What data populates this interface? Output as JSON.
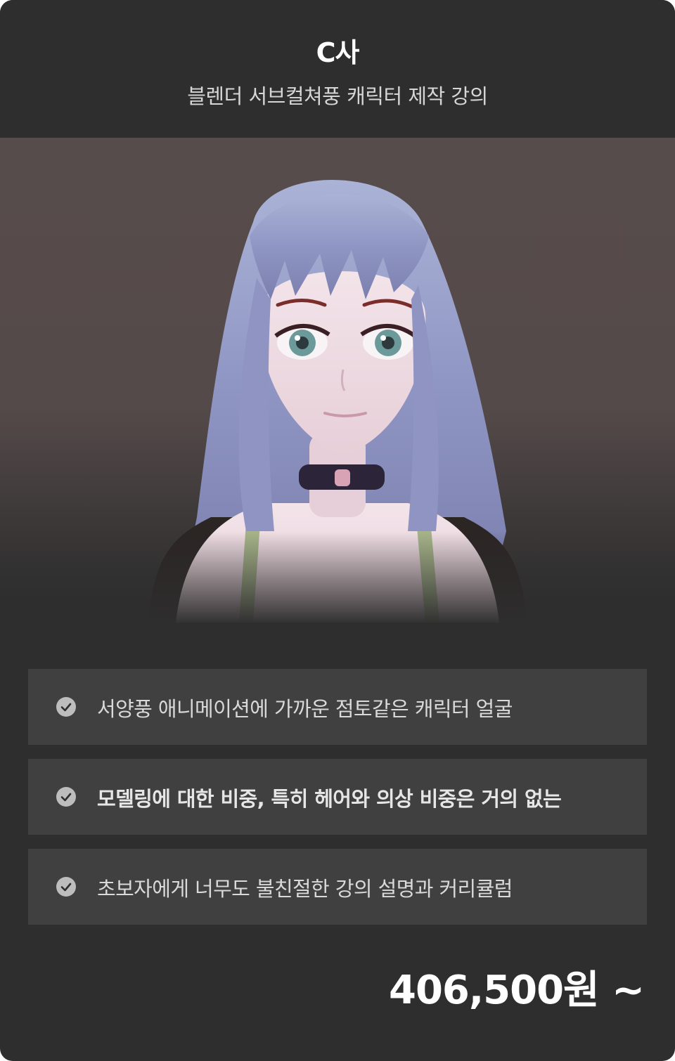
{
  "header": {
    "title": "C사",
    "subtitle": "블렌더 서브컬쳐풍 캐릭터 제작 강의"
  },
  "hero": {
    "image": "3d-anime-character-portrait"
  },
  "features": [
    {
      "icon": "check-circle-icon",
      "label": "서양풍 애니메이션에 가까운 점토같은 캐릭터 얼굴",
      "emphasis": false
    },
    {
      "icon": "check-circle-icon",
      "label": "모델링에 대한 비중, 특히 헤어와 의상 비중은 거의 없는",
      "emphasis": true
    },
    {
      "icon": "check-circle-icon",
      "label": "초보자에게 너무도 불친절한 강의 설명과 커리큘럼",
      "emphasis": false
    }
  ],
  "price": {
    "label": "406,500원 ~"
  },
  "colors": {
    "card_bg": "#2e2e2e",
    "feature_bg": "#404040",
    "hero_bg": "#554a4a",
    "check_bg": "#bdbdbd"
  }
}
